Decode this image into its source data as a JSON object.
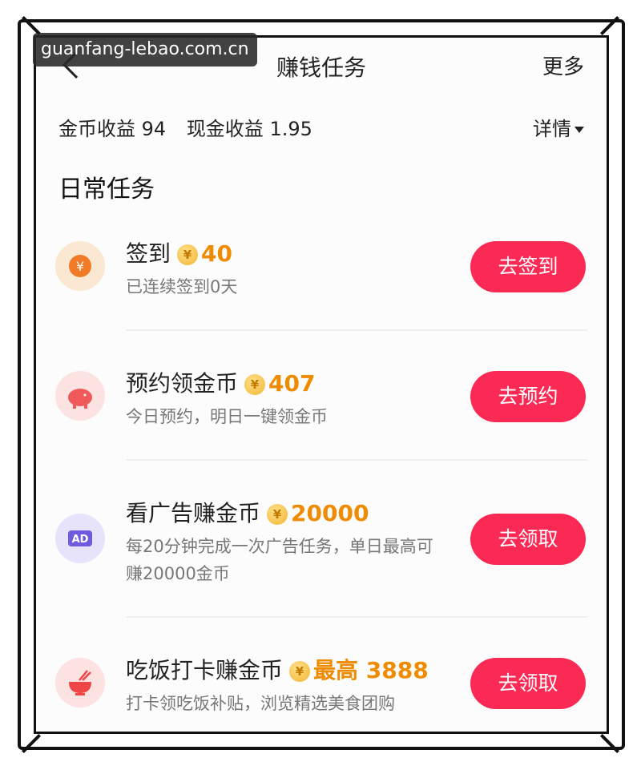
{
  "watermark": "guanfang-lebao.com.cn",
  "header": {
    "title": "赚钱任务",
    "more": "更多"
  },
  "earnings": {
    "coin_label": "金币收益 94",
    "cash_label": "现金收益 1.95",
    "details": "详情"
  },
  "section_title": "日常任务",
  "tasks": [
    {
      "title": "签到",
      "coin_symbol": "¥",
      "reward": "40",
      "desc": "已连续签到0天",
      "button": "去签到",
      "icon": "yuan-coin-icon"
    },
    {
      "title": "预约领金币",
      "coin_symbol": "¥",
      "reward": "407",
      "desc": "今日预约，明日一键领金币",
      "button": "去预约",
      "icon": "piggy-bank-icon"
    },
    {
      "title": "看广告赚金币",
      "coin_symbol": "¥",
      "reward": "20000",
      "desc": "每20分钟完成一次广告任务，单日最高可赚20000金币",
      "button": "去领取",
      "icon": "ad-icon",
      "icon_text": "AD"
    },
    {
      "title": "吃饭打卡赚金币",
      "coin_symbol": "¥",
      "reward": "最高 3888",
      "desc": "打卡领吃饭补贴，浏览精选美食团购",
      "button": "去领取",
      "icon": "rice-bowl-icon"
    }
  ],
  "colors": {
    "accent": "#fb2a55",
    "reward": "#ee8b00"
  }
}
